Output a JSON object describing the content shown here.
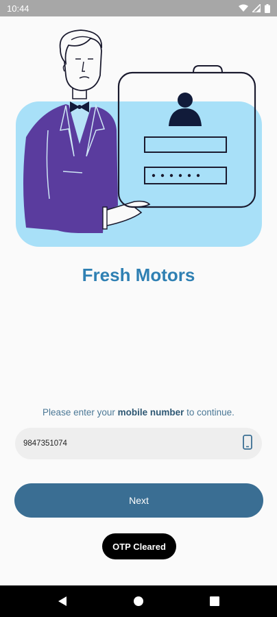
{
  "status_bar": {
    "time": "10:44",
    "icons": [
      "wifi-icon",
      "signal-icon",
      "battery-icon"
    ]
  },
  "hero": {
    "illustration": "person-presenting-login-card"
  },
  "app": {
    "title": "Fresh Motors"
  },
  "login": {
    "prompt_prefix": "Please enter your ",
    "prompt_bold": "mobile number",
    "prompt_suffix": " to continue.",
    "phone_value": "9847351074",
    "phone_icon": "mobile-phone-icon",
    "next_label": "Next"
  },
  "toast": {
    "message": "OTP Cleared"
  },
  "nav_bar": {
    "icons": [
      "back-icon",
      "home-icon",
      "recents-icon"
    ]
  },
  "colors": {
    "accent": "#2f80b3",
    "button": "#3a6e93",
    "hero_bg": "#a8e0f8",
    "suit": "#5a3c9e"
  }
}
